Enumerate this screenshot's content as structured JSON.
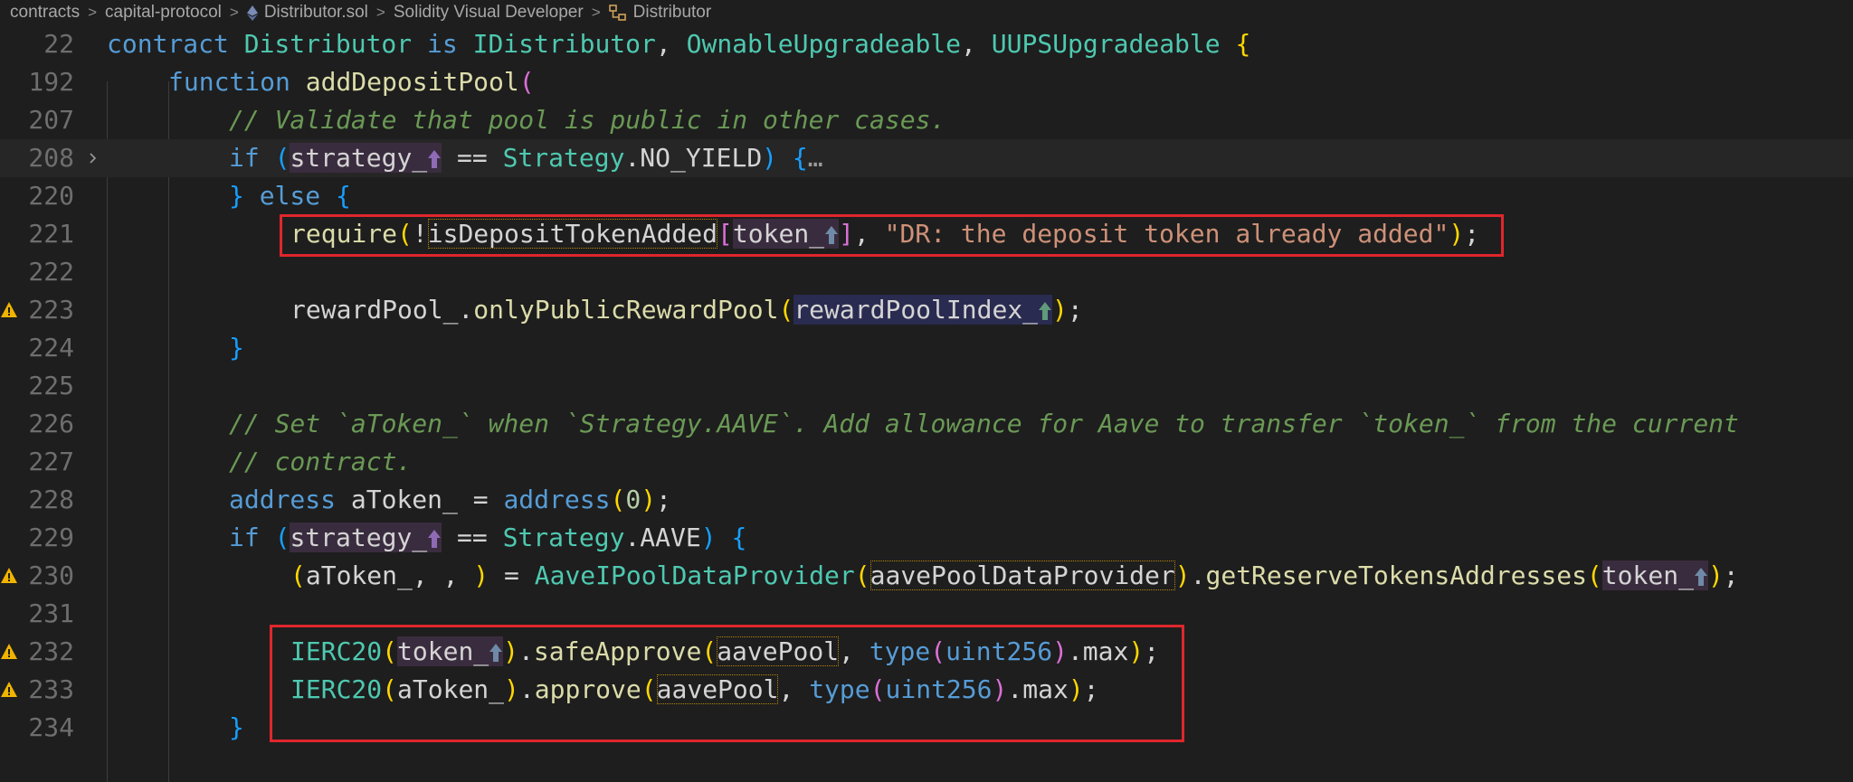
{
  "breadcrumb": {
    "items": [
      "contracts",
      "capital-protocol",
      "Distributor.sol",
      "Solidity Visual Developer",
      "Distributor"
    ],
    "separator": ">"
  },
  "editor": {
    "language": "Solidity",
    "current_line": "208",
    "lines": [
      {
        "num": "22",
        "code": "contract Distributor is IDistributor, OwnableUpgradeable, UUPSUpgradeable {"
      },
      {
        "num": "192",
        "code": "function addDepositPool("
      },
      {
        "num": "207",
        "code": "// Validate that pool is public in other cases."
      },
      {
        "num": "208",
        "code": "if (strategy_ == Strategy.NO_YIELD) {…",
        "folded": true
      },
      {
        "num": "220",
        "code": "} else {"
      },
      {
        "num": "221",
        "code": "require(!isDepositTokenAdded[token_], \"DR: the deposit token already added\");",
        "highlighted": true
      },
      {
        "num": "222",
        "code": ""
      },
      {
        "num": "223",
        "code": "rewardPool_.onlyPublicRewardPool(rewardPoolIndex_);",
        "warning": true
      },
      {
        "num": "224",
        "code": "}"
      },
      {
        "num": "225",
        "code": ""
      },
      {
        "num": "226",
        "code": "// Set `aToken_` when `Strategy.AAVE`. Add allowance for Aave to transfer `token_` from the current"
      },
      {
        "num": "227",
        "code": "// contract."
      },
      {
        "num": "228",
        "code": "address aToken_ = address(0);"
      },
      {
        "num": "229",
        "code": "if (strategy_ == Strategy.AAVE) {"
      },
      {
        "num": "230",
        "code": "(aToken_, , ) = AaveIPoolDataProvider(aavePoolDataProvider).getReserveTokensAddresses(token_);",
        "warning": true
      },
      {
        "num": "231",
        "code": ""
      },
      {
        "num": "232",
        "code": "IERC20(token_).safeApprove(aavePool, type(uint256).max);",
        "warning": true,
        "highlighted": true
      },
      {
        "num": "233",
        "code": "IERC20(aToken_).approve(aavePool, type(uint256).max);",
        "warning": true,
        "highlighted": true
      },
      {
        "num": "234",
        "code": "}"
      }
    ]
  },
  "icons": {
    "solidity-file": "ethereum-diamond-icon",
    "contract-symbol": "class-symbol-icon",
    "warning": "warning-triangle-icon",
    "fold": "chevron-right-icon",
    "param-marker": "up-arrow-icon"
  },
  "colors": {
    "background": "#1e1e1e",
    "keyword": "#569cd6",
    "type": "#4ec9b0",
    "function": "#dcdcaa",
    "comment": "#6a9955",
    "string": "#ce9178",
    "highlight_box": "#e0262d",
    "warning": "#f0b400"
  }
}
